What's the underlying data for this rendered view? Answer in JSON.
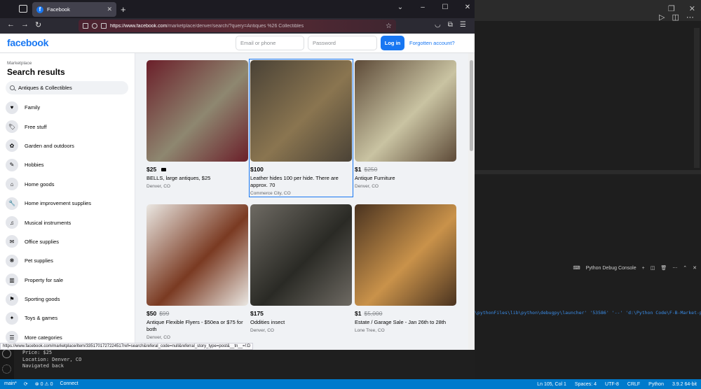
{
  "browser": {
    "tab_title": "Facebook",
    "url_domain": "https://www.facebook.com",
    "url_path": "/marketplace/denver/search/?query=Antiques %26 Collectibles",
    "status_url": "https://www.facebook.com/marketplace/item/3351701727224517ref=search&referal_code=null&referral_story_type=post&__tn__=!:D"
  },
  "fb": {
    "logo": "facebook",
    "email_placeholder": "Email or phone",
    "password_placeholder": "Password",
    "login_label": "Log in",
    "forgot_label": "Forgotten account?"
  },
  "sidebar": {
    "crumb": "Marketplace",
    "title": "Search results",
    "search_value": "Antiques & Collectibles",
    "categories": [
      {
        "label": "Family",
        "icon": "heart-icon",
        "glyph": "♥"
      },
      {
        "label": "Free stuff",
        "icon": "tag-icon",
        "glyph": "🏷"
      },
      {
        "label": "Garden and outdoors",
        "icon": "leaf-icon",
        "glyph": "✿"
      },
      {
        "label": "Hobbies",
        "icon": "pencil-icon",
        "glyph": "✎"
      },
      {
        "label": "Home goods",
        "icon": "house-icon",
        "glyph": "⌂"
      },
      {
        "label": "Home improvement supplies",
        "icon": "wrench-icon",
        "glyph": "🔧"
      },
      {
        "label": "Musical instruments",
        "icon": "music-icon",
        "glyph": "♫"
      },
      {
        "label": "Office supplies",
        "icon": "tag-icon",
        "glyph": "✉"
      },
      {
        "label": "Pet supplies",
        "icon": "paw-icon",
        "glyph": "❋"
      },
      {
        "label": "Property for sale",
        "icon": "building-icon",
        "glyph": "▥"
      },
      {
        "label": "Sporting goods",
        "icon": "runner-icon",
        "glyph": "⚑"
      },
      {
        "label": "Toys & games",
        "icon": "puzzle-icon",
        "glyph": "✦"
      },
      {
        "label": "More categories",
        "icon": "list-icon",
        "glyph": "☰"
      }
    ]
  },
  "listings": [
    {
      "price": "$25",
      "old_price": "",
      "video": true,
      "title": "BELLS, large antiques, $25",
      "location": "Denver, CO",
      "colors": [
        "#6b1f2a",
        "#8e8770"
      ]
    },
    {
      "price": "$100",
      "old_price": "",
      "video": false,
      "title": "Leather hides 100 per hide. There are approx. 70",
      "location": "Commerce City, CO",
      "colors": [
        "#4a4236",
        "#8a7550"
      ]
    },
    {
      "price": "$1",
      "old_price": "$250",
      "video": false,
      "title": "Antique Furniture",
      "location": "Denver, CO",
      "colors": [
        "#5d4a38",
        "#c9c3a2"
      ]
    },
    {
      "price": "$50",
      "old_price": "$99",
      "video": false,
      "title": "Antique Flexible Flyers - $50ea or $75 for both",
      "location": "Denver, CO",
      "colors": [
        "#eae7e2",
        "#7a3a22"
      ]
    },
    {
      "price": "$175",
      "old_price": "",
      "video": false,
      "title": "Oddities insect",
      "location": "Denver, CO",
      "colors": [
        "#6e6a63",
        "#2a2a25"
      ]
    },
    {
      "price": "$1",
      "old_price": "$5,000",
      "video": false,
      "title": "Estate / Garage Sale - Jan 26th to 28th",
      "location": "Lone Tree, CO",
      "colors": [
        "#4a3320",
        "#c9924a"
      ]
    }
  ],
  "vscode": {
    "panel_label": "Python Debug Console",
    "term_cmd": "\\pythonFiles\\lib\\python\\debugpy\\launcher' '53586' '--' 'd:\\Python Code\\F-B-Market-plac",
    "term_lines": [
      "Price: $25",
      "Location: Denver, CO",
      "Navigated back"
    ],
    "status_left": [
      "main*",
      "⟳",
      "⊗ 0 ⚠ 0",
      "Connect"
    ],
    "status_right": [
      "Ln 105, Col 1",
      "Spaces: 4",
      "UTF-8",
      "CRLF",
      "Python",
      "3.9.2 64-bit"
    ]
  }
}
